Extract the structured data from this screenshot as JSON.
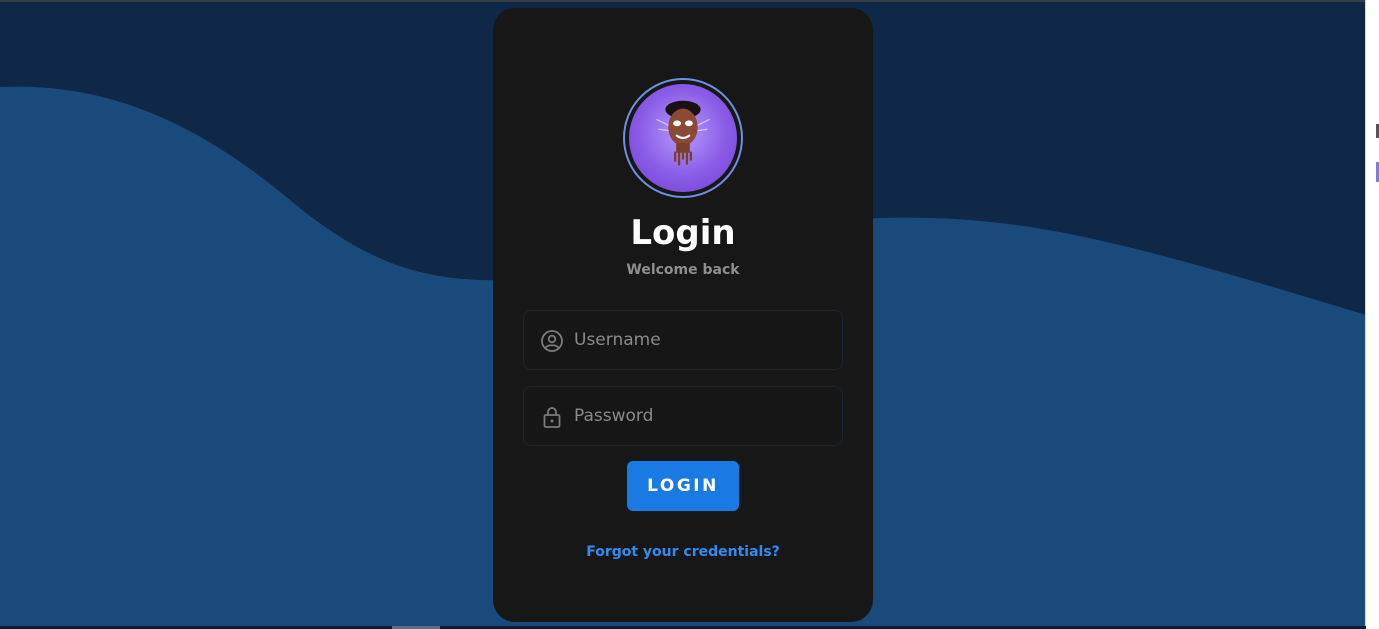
{
  "colors": {
    "background_dark": "#0f2847",
    "wave_light": "#1a4a7c",
    "card": "#171717",
    "accent": "#1a7ae3",
    "link": "#2f8df2",
    "avatar_purple": "#8a5be6"
  },
  "header": {
    "title": "Login",
    "subtitle": "Welcome back"
  },
  "avatar": {
    "icon": "user-avatar-illustration"
  },
  "form": {
    "username": {
      "icon": "user-circle-icon",
      "placeholder": "Username",
      "value": ""
    },
    "password": {
      "icon": "lock-icon",
      "placeholder": "Password",
      "value": ""
    },
    "submit_label": "LOGIN"
  },
  "links": {
    "forgot": "Forgot your credentials?"
  }
}
